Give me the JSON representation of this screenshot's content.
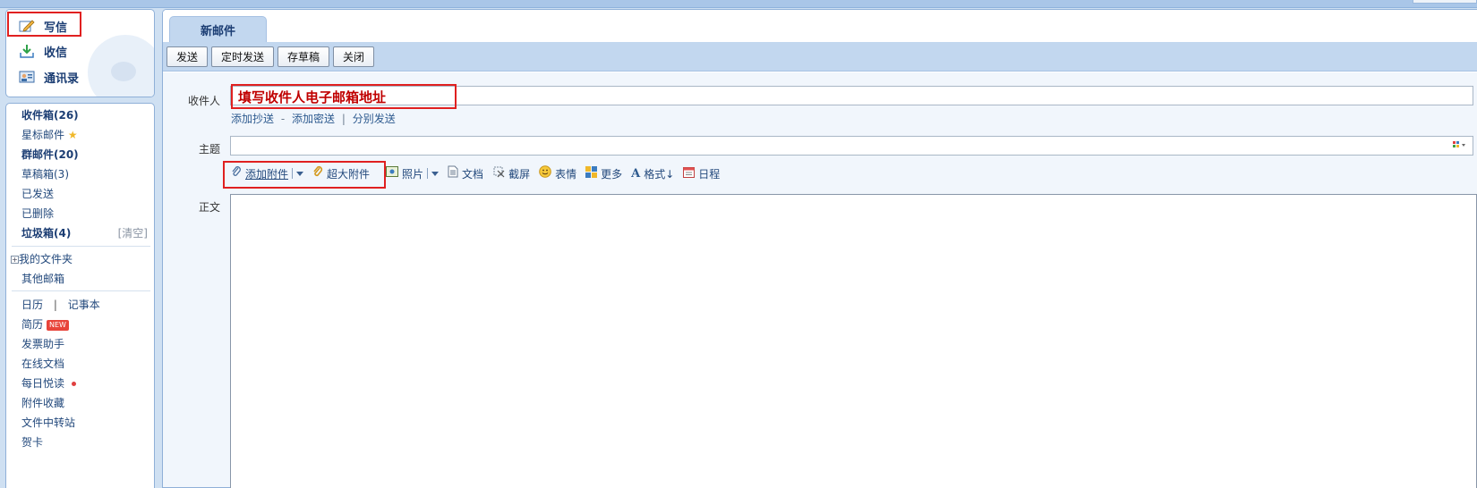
{
  "sidebar": {
    "quick": {
      "compose": "写信",
      "inbox": "收信",
      "contacts": "通讯录"
    },
    "folders": {
      "inbox": "收件箱(26)",
      "starred": "星标邮件",
      "group_mail": "群邮件(20)",
      "drafts": "草稿箱(3)",
      "sent": "已发送",
      "deleted": "已删除",
      "spam": "垃圾箱(4)",
      "spam_clear": "[清空]",
      "my_folders": "我的文件夹",
      "other_mailboxes": "其他邮箱"
    },
    "apps": {
      "calendar": "日历",
      "separator": "|",
      "notes": "记事本",
      "resume": "简历",
      "resume_badge": "NEW",
      "invoice": "发票助手",
      "online_docs": "在线文档",
      "daily_reading": "每日悦读",
      "attachment_fav": "附件收藏",
      "file_transfer": "文件中转站",
      "cards": "贺卡"
    }
  },
  "tab": {
    "title": "新邮件"
  },
  "toolbar": {
    "send": "发送",
    "scheduled_send": "定时发送",
    "save_draft": "存草稿",
    "close": "关闭"
  },
  "compose": {
    "to_label": "收件人",
    "to_hint": "填写收件人电子邮箱地址",
    "add_cc": "添加抄送",
    "dash": "-",
    "add_bcc": "添加密送",
    "pipe": "|",
    "separate_send": "分别发送",
    "subject_label": "主题",
    "body_label": "正文"
  },
  "attach_bar": {
    "add_attachment": "添加附件",
    "large_attachment": "超大附件",
    "photo": "照片",
    "document": "文档",
    "screenshot": "截屏",
    "emoji": "表情",
    "more": "更多",
    "format": "格式↓",
    "schedule": "日程"
  },
  "icons": {
    "compose": "pencil-note-icon",
    "inbox": "download-tray-icon",
    "contacts": "address-card-icon",
    "star": "star-icon",
    "expand": "plus-box-icon",
    "attach": "paperclip-icon",
    "photo": "image-icon",
    "doc": "document-icon",
    "screenshot": "scissors-icon",
    "emoji": "smiley-icon",
    "more": "grid-icon",
    "format": "font-a-icon",
    "schedule": "calendar-icon"
  },
  "colors": {
    "highlight_box": "#e02020",
    "hint_text": "#c00000",
    "panel_blue": "#c2d7ef",
    "link_blue": "#2d5a8f"
  }
}
